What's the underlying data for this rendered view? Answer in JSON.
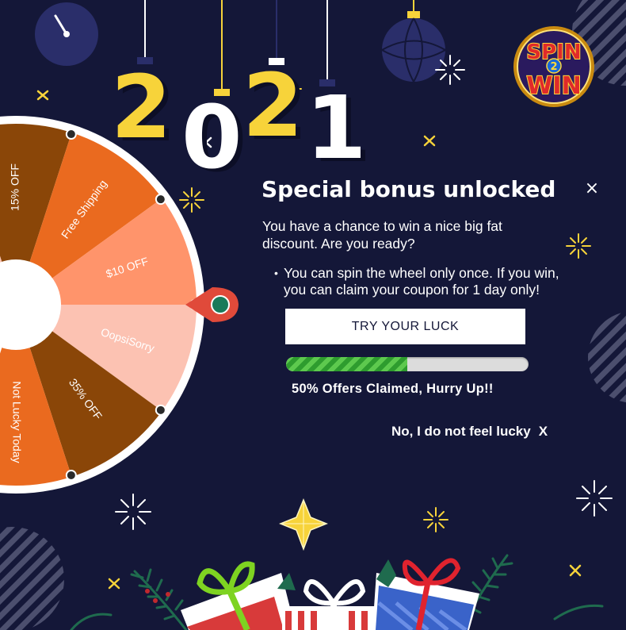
{
  "year_digits": [
    "2",
    "0",
    "2",
    "1"
  ],
  "logo": {
    "line1": "SPIN",
    "middle": "2",
    "line2": "WIN"
  },
  "popup": {
    "title": "Special bonus unlocked",
    "description": "You have a chance to win a nice big fat discount. Are you ready?",
    "bullet_marker": "•",
    "bullet": "You can spin the wheel only once. If you win, you can claim your coupon for 1 day only!",
    "cta_label": "TRY YOUR LUCK",
    "progress_fraction": 0.5,
    "claimed_text": "50% Offers Claimed, Hurry Up!!",
    "decline_label": "No, I do not feel lucky",
    "decline_x": "X",
    "close_icon": "×"
  },
  "wheel": {
    "segments": [
      {
        "label": "OopsiSorry",
        "color": "#fcc2b2",
        "text_color": "#ffffff"
      },
      {
        "label": "15% OFF",
        "color": "#8a4608",
        "text_color": "#ffffff"
      },
      {
        "label": "Free Shipping",
        "color": "#ea6a1f",
        "text_color": "#ffffff"
      },
      {
        "label": "$10 OFF",
        "color": "#ff946b",
        "text_color": "#ffffff"
      },
      {
        "label": "OopsiSorry",
        "color": "#fcc2b2",
        "text_color": "#ffffff"
      },
      {
        "label": "35% OFF",
        "color": "#8a4608",
        "text_color": "#ffffff"
      },
      {
        "label": "Not Lucky Today",
        "color": "#ea6a1f",
        "text_color": "#ffffff"
      }
    ]
  },
  "colors": {
    "background": "#141738",
    "accent_yellow": "#f7d33a",
    "progress_green": "#3aa53a",
    "pointer_red": "#e04a3a"
  }
}
